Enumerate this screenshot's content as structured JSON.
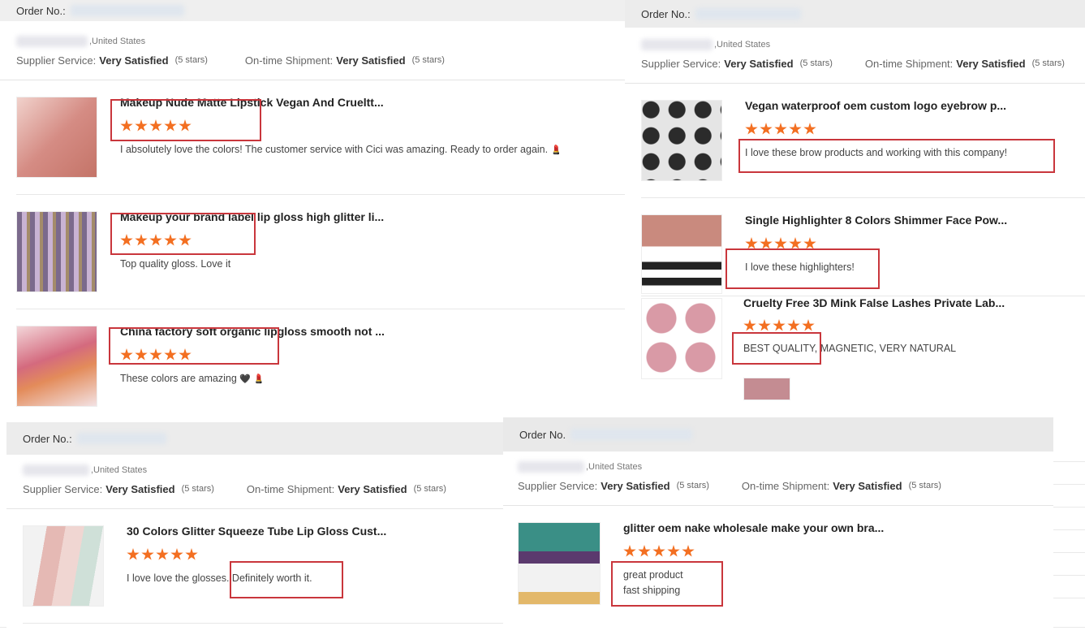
{
  "shared": {
    "order_label": "Order No.:",
    "order_label_short": "Order No.",
    "location": ",United States",
    "supplier_service_label": "Supplier Service:",
    "ontime_label": "On-time Shipment:",
    "rating_text": "Very Satisfied",
    "rating_stars": "(5 stars)",
    "star_count": 5,
    "accent_color": "#f36f21",
    "highlight_color": "#c9363c"
  },
  "panels": [
    {
      "items": [
        {
          "title": "Makeup Nude Matte Lipstick Vegan And Crueltt...",
          "review": "I absolutely love the colors! The customer service with Cici was amazing. Ready to order again.",
          "emoji": "💄",
          "thumb_color": "#d58c84"
        },
        {
          "title": "Makeup your brand label lip gloss high glitter li...",
          "review": "Top quality gloss. Love it",
          "thumb_color": "#b59bc4"
        },
        {
          "title": "China factory soft organic lipgloss smooth not ...",
          "review": "These colors are amazing",
          "emoji": "🖤 💄",
          "thumb_color": "#d46a7e"
        }
      ]
    },
    {
      "items": [
        {
          "title": "Vegan waterproof oem custom logo eyebrow p...",
          "review": "I love these brow products and working with this company!",
          "thumb_color": "#3b3b3b"
        },
        {
          "title": "Single Highlighter 8 Colors Shimmer Face Pow...",
          "review": "I love these highlighters!",
          "thumb_color": "#c98a7e"
        },
        {
          "title": "Cruelty Free 3D Mink False Lashes Private Lab...",
          "review": "BEST QUALITY, MAGNETIC, VERY NATURAL",
          "thumb_color": "#d99aa6"
        }
      ]
    },
    {
      "items": [
        {
          "title": "30 Colors Glitter Squeeze Tube Lip Gloss Cust...",
          "review": "I love love the glosses. Definitely worth it.",
          "thumb_color": "#e5b9b4"
        }
      ]
    },
    {
      "items": [
        {
          "title": "glitter oem nake wholesale make your own bra...",
          "review_line1": "great product",
          "review_line2": "fast shipping",
          "thumb_color": "#3a8f86"
        }
      ]
    }
  ]
}
